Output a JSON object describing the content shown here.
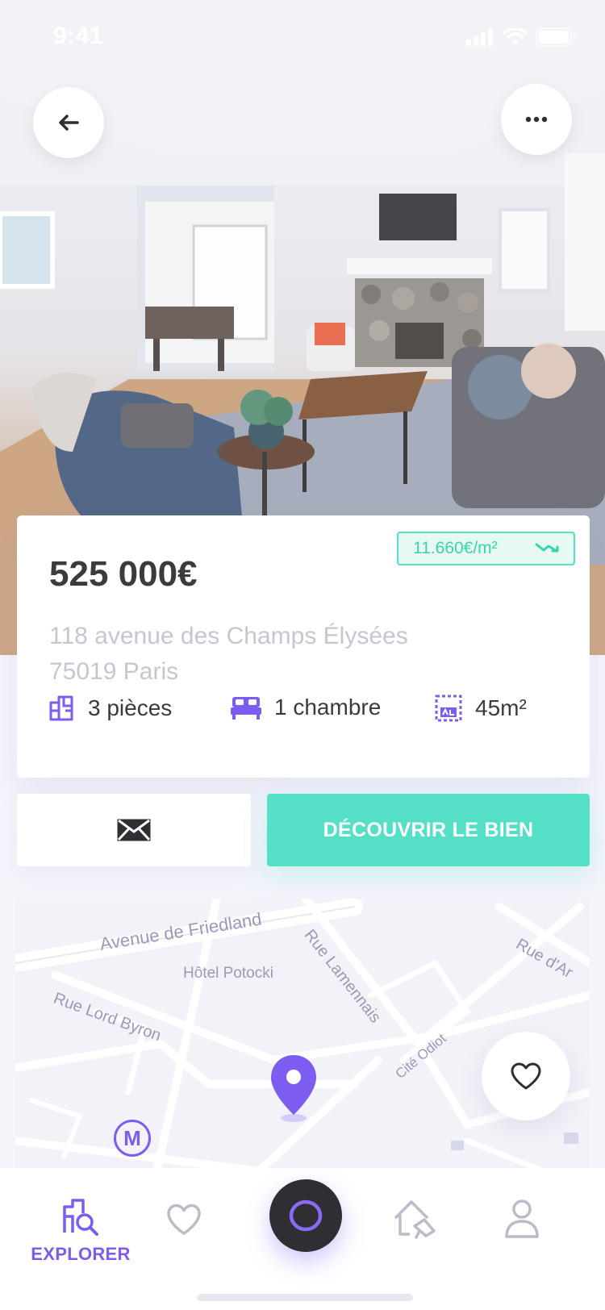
{
  "status_bar": {
    "time": "9:41"
  },
  "listing": {
    "price": "525 000€",
    "price_per_m2": "11.660€/m²",
    "address_line1": "118 avenue des Champs Élysées",
    "address_line2": "75019 Paris",
    "features": {
      "rooms": "3 pièces",
      "bedrooms": "1 chambre",
      "surface": "45m²"
    }
  },
  "actions": {
    "cta_label": "DÉCOUVRIR LE BIEN"
  },
  "map": {
    "streets": {
      "friedland": "Avenue de Friedland",
      "lamennais": "Rue Lamennais",
      "rue_d_ar": "Rue d'Ar",
      "potocki": "Hôtel Potocki",
      "lord_byron": "Rue Lord Byron",
      "cite_odiot": "Cité Odiot"
    },
    "metro_label": "M"
  },
  "tabbar": {
    "explorer_label": "EXPLORER"
  },
  "colors": {
    "accent": "#7d5cf0",
    "cta": "#53e0c6",
    "price_badge": "#3ad3ad"
  },
  "icons": [
    "back-arrow-icon",
    "more-dots-icon",
    "trend-icon",
    "rooms-icon",
    "bed-icon",
    "surface-icon",
    "mail-icon",
    "map-pin-icon",
    "metro-icon",
    "heart-icon",
    "explorer-icon",
    "home-search-icon",
    "profile-icon"
  ]
}
